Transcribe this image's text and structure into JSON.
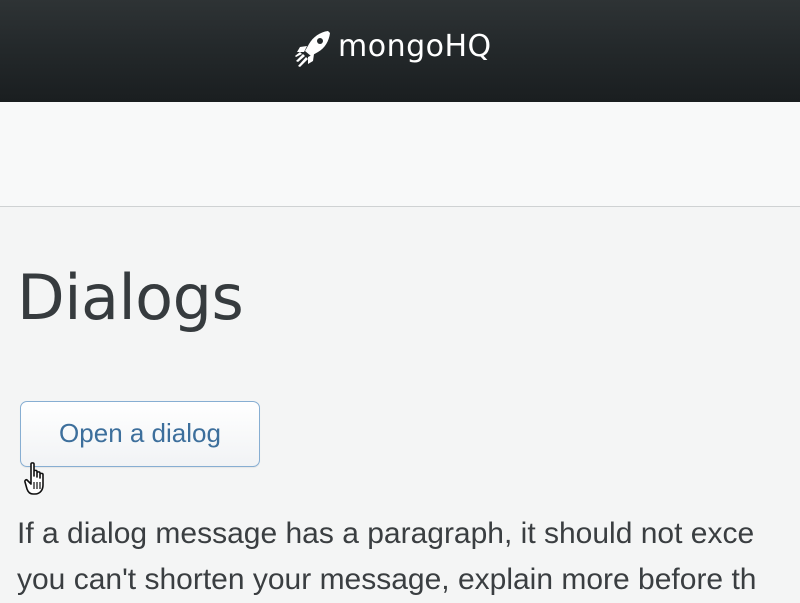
{
  "header": {
    "brand_name": "mongoHQ",
    "logo_icon": "rocket-icon"
  },
  "main": {
    "page_title": "Dialogs",
    "open_button_label": "Open a dialog",
    "paragraph_line_1": "If a dialog message has a paragraph, it should not exce",
    "paragraph_line_2": "you can't shorten your message, explain more before th"
  },
  "cursor": {
    "icon": "hand-pointer-icon"
  },
  "colors": {
    "header_bg": "#24292b",
    "button_border": "#87aed2",
    "button_text": "#3d6f9c",
    "title_text": "#363b3e"
  }
}
